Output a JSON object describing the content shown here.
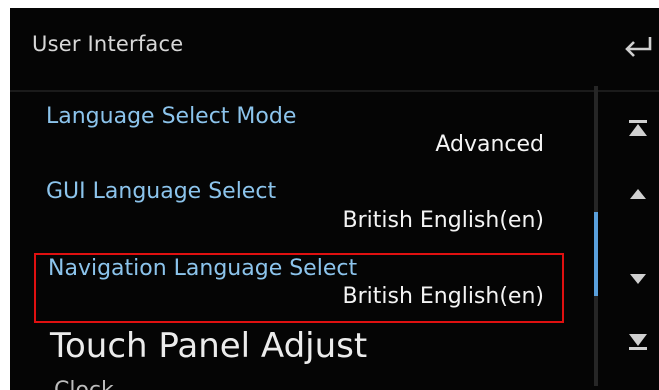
{
  "header": {
    "title": "User Interface",
    "back_icon": "back-arrow-icon"
  },
  "settings": [
    {
      "label": "Language Select Mode",
      "value": "Advanced"
    },
    {
      "label": "GUI Language Select",
      "value": "British English(en)"
    },
    {
      "label": "Navigation Language Select",
      "value": "British English(en)"
    }
  ],
  "touch_panel": {
    "label": "Touch Panel Adjust"
  },
  "partial_item": {
    "label": "Clock"
  },
  "scroll_controls": [
    "scroll-top-icon",
    "scroll-up-icon",
    "scroll-down-icon",
    "scroll-bottom-icon"
  ],
  "colors": {
    "background": "#050505",
    "label": "#8cc4ec",
    "value": "#f4f4f4",
    "highlight": "#e01010",
    "scroll_thumb": "#5aa0dc"
  }
}
